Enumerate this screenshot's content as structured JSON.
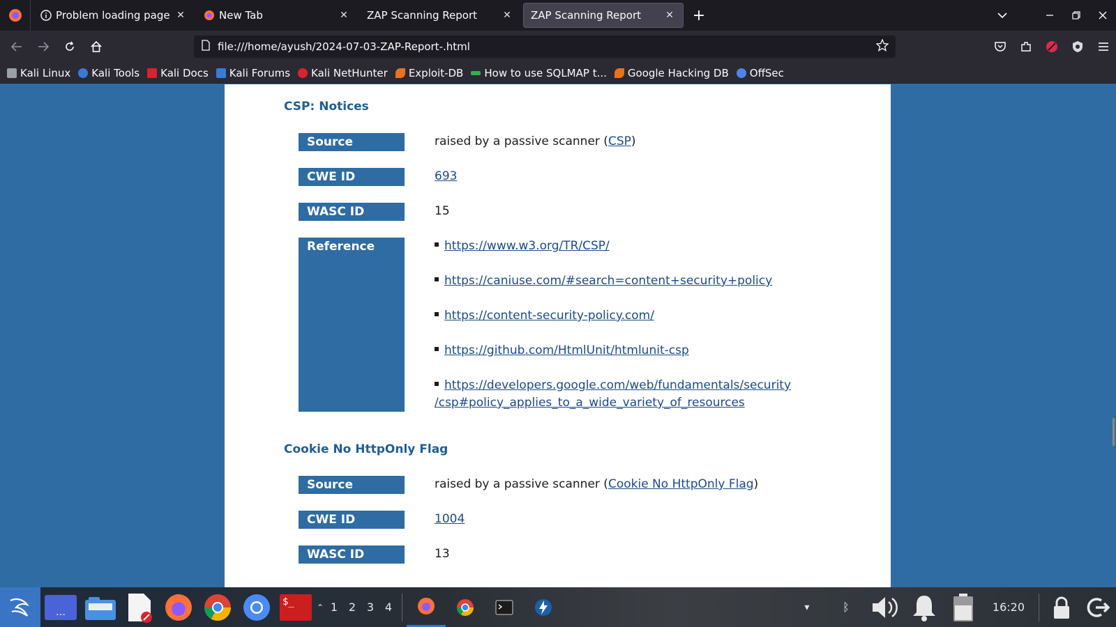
{
  "browser": {
    "tabs": [
      {
        "title": "Problem loading page",
        "icon": "info-icon",
        "active": false
      },
      {
        "title": "New Tab",
        "icon": "firefox-icon",
        "active": false
      },
      {
        "title": "ZAP Scanning Report",
        "icon": "",
        "active": false
      },
      {
        "title": "ZAP Scanning Report",
        "icon": "",
        "active": true
      }
    ],
    "url": "file:///home/ayush/2024-07-03-ZAP-Report-.html",
    "bookmarks": [
      {
        "label": "Kali Linux",
        "icon": "kali-dragon-icon",
        "color": "#9aa0a6"
      },
      {
        "label": "Kali Tools",
        "icon": "kali-tools-icon",
        "color": "#3a7bd5"
      },
      {
        "label": "Kali Docs",
        "icon": "kali-docs-icon",
        "color": "#d9232d"
      },
      {
        "label": "Kali Forums",
        "icon": "kali-forums-icon",
        "color": "#3a7bd5"
      },
      {
        "label": "Kali NetHunter",
        "icon": "nethunter-icon",
        "color": "#d9232d"
      },
      {
        "label": "Exploit-DB",
        "icon": "exploit-db-icon",
        "color": "#e8731a"
      },
      {
        "label": "How to use SQLMAP t...",
        "icon": "sqlmap-icon",
        "color": "#2fb34a"
      },
      {
        "label": "Google Hacking DB",
        "icon": "ghdb-icon",
        "color": "#e8731a"
      },
      {
        "label": "OffSec",
        "icon": "offsec-icon",
        "color": "#4a86e8"
      }
    ]
  },
  "report": {
    "sections": [
      {
        "title": "CSP: Notices",
        "source_prefix": "raised by a passive scanner (",
        "source_link": "CSP",
        "source_suffix": ")",
        "cwe_id": "693",
        "wasc_id": "15",
        "references": [
          "https://www.w3.org/TR/CSP/",
          "https://caniuse.com/#search=content+security+policy",
          "https://content-security-policy.com/",
          "https://github.com/HtmlUnit/htmlunit-csp",
          "https://developers.google.com/web/fundamentals/security",
          "/csp#policy_applies_to_a_wide_variety_of_resources"
        ]
      },
      {
        "title": "Cookie No HttpOnly Flag",
        "source_prefix": "raised by a passive scanner (",
        "source_link": "Cookie No HttpOnly Flag",
        "source_suffix": ")",
        "cwe_id": "1004",
        "wasc_id": "13"
      }
    ],
    "labels": {
      "source": "Source",
      "cwe": "CWE ID",
      "wasc": "WASC ID",
      "reference": "Reference"
    }
  },
  "taskbar": {
    "workspaces": [
      "1",
      "2",
      "3",
      "4"
    ],
    "clock": "16:20"
  }
}
